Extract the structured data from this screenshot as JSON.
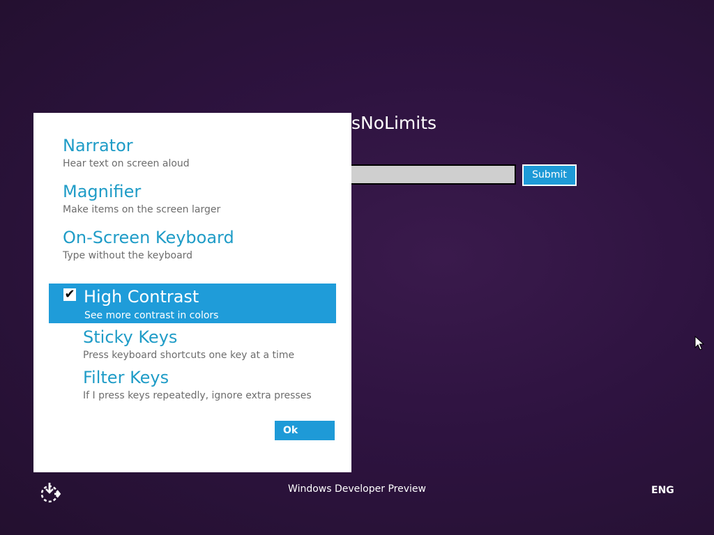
{
  "login": {
    "user_name": "sNoLimits",
    "password_value": "",
    "submit_label": "Submit"
  },
  "ease_panel": {
    "options": [
      {
        "title": "Narrator",
        "desc": "Hear text on screen aloud"
      },
      {
        "title": "Magnifier",
        "desc": "Make items on the screen larger"
      },
      {
        "title": "On-Screen Keyboard",
        "desc": "Type without the keyboard"
      }
    ],
    "toggles": [
      {
        "title": "High Contrast",
        "desc": "See more contrast in colors",
        "checked": true,
        "check_glyph": "✔"
      },
      {
        "title": "Sticky Keys",
        "desc": "Press keyboard shortcuts one key at a time",
        "checked": false
      },
      {
        "title": "Filter Keys",
        "desc": "If I press keys repeatedly, ignore extra presses",
        "checked": false
      }
    ],
    "ok_label": "Ok"
  },
  "footer": {
    "brand": "Windows Developer Preview",
    "language": "ENG"
  },
  "icons": {
    "ease_of_access": "ease-of-access-icon",
    "cursor": "mouse-cursor-icon",
    "checkbox": "checkmark-icon"
  },
  "colors": {
    "background": "#2e1340",
    "accent": "#1e9ad7",
    "option_title": "#1f9cc7",
    "option_desc": "#6d6d6d",
    "panel": "#ffffff"
  }
}
